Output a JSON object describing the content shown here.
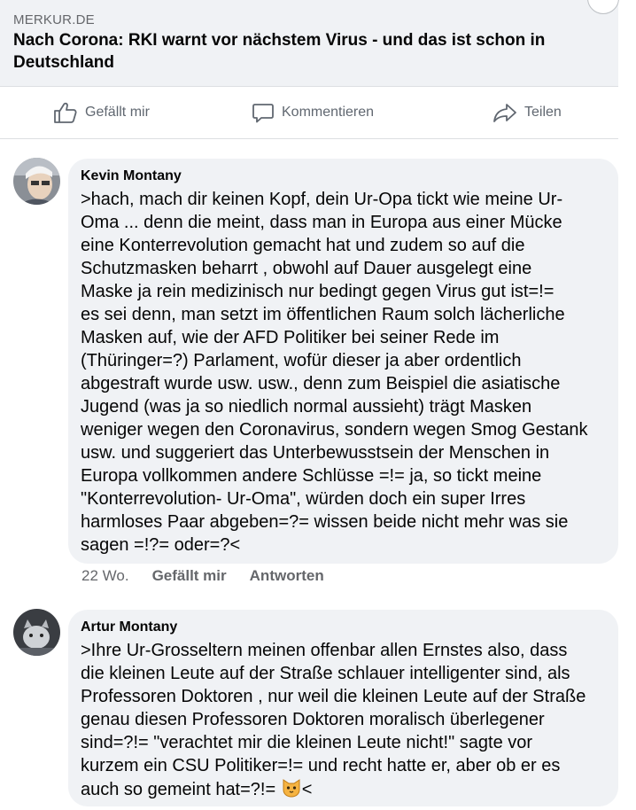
{
  "link_preview": {
    "domain": "MERKUR.DE",
    "headline": "Nach Corona: RKI warnt vor nächstem Virus - und das ist schon in Deutschland"
  },
  "actions": {
    "like": "Gefällt mir",
    "comment": "Kommentieren",
    "share": "Teilen"
  },
  "comments": [
    {
      "author": "Kevin Montany",
      "text": ">hach, mach dir keinen Kopf, dein Ur-Opa tickt wie meine Ur-\nOma ... denn die meint, dass man in Europa aus einer Mücke\neine Konterrevolution gemacht hat und zudem so auf die\nSchutzmasken beharrt , obwohl auf Dauer ausgelegt eine\nMaske ja  rein medizinisch nur bedingt gegen Virus  gut ist=!=\nes sei denn, man setzt im öffentlichen Raum solch lächerliche\nMasken auf, wie der AFD Politiker bei seiner Rede im\n(Thüringer=?) Parlament, wofür dieser ja aber ordentlich\nabgestraft wurde usw. usw., denn zum Beispiel  die asiatische\nJugend (was ja so niedlich normal aussieht) trägt Masken\nweniger wegen den Coronavirus, sondern wegen Smog Gestank\nusw. und suggeriert das Unterbewusstsein der  Menschen in\nEuropa vollkommen andere Schlüsse =!= ja, so tickt meine\n\"Konterrevolution- Ur-Oma\", würden doch ein super Irres\nharmloses Paar abgeben=?= wissen beide nicht mehr was sie\nsagen =!?= oder=?<",
      "time": "22 Wo.",
      "like": "Gefällt mir",
      "reply": "Antworten"
    },
    {
      "author": "Artur Montany",
      "text": ">Ihre Ur-Grosseltern meinen offenbar allen Ernstes also, dass\ndie kleinen Leute auf der Straße schlauer intelligenter sind, als\nProfessoren Doktoren , nur weil die kleinen Leute auf der Straße\ngenau diesen Professoren Doktoren moralisch überlegener\nsind=?!= \"verachtet mir die kleinen Leute nicht!\" sagte vor\nkurzem ein CSU Politiker=!= und recht hatte er, aber ob er es\nauch so gemeint hat=?!= ",
      "text_end": "<"
    }
  ]
}
